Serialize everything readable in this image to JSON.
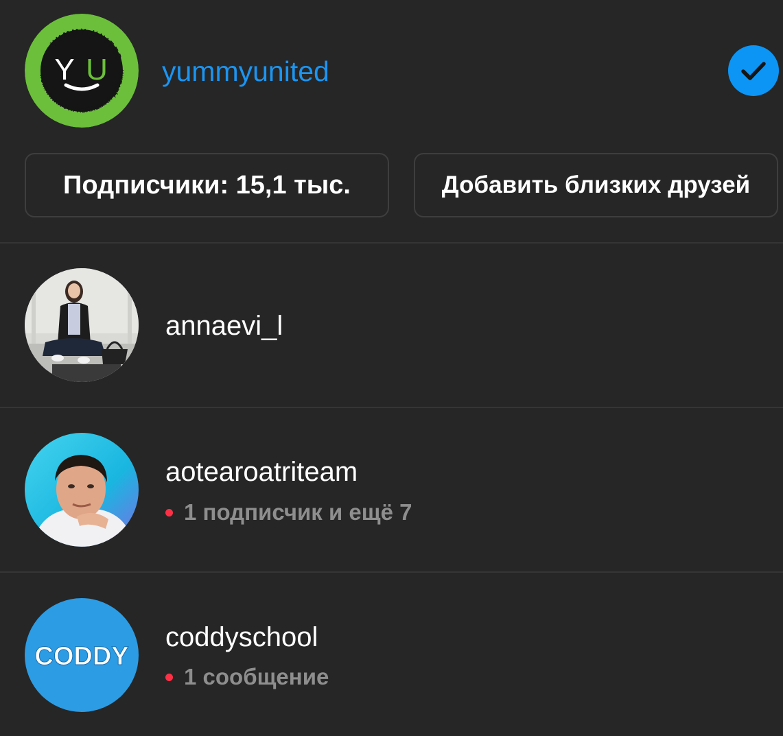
{
  "account": {
    "username": "yummyunited",
    "logo_letters": "YU",
    "logo_ring_text": "YUMMY UNITED · КОМПАНИЯ УПРАВЛЯЕМАЯ ДЕТЬМИ",
    "selected": true
  },
  "buttons": {
    "followers_label": "Подписчики: 15,1 тыс.",
    "close_friends_label": "Добавить близких друзей"
  },
  "accounts": [
    {
      "username": "annaevi_l",
      "subtitle": ""
    },
    {
      "username": "aotearoatriteam",
      "subtitle": "1 подписчик и ещё 7"
    },
    {
      "username": "coddyschool",
      "subtitle": "1 сообщение",
      "logo_text": "CODDY"
    }
  ],
  "colors": {
    "background": "#262626",
    "username_link": "#1b95f2",
    "check_badge": "#0d95f5",
    "notification_dot": "#ff3046",
    "coddy_blue": "#2c9ce4",
    "yu_green": "#6cbf3b"
  }
}
